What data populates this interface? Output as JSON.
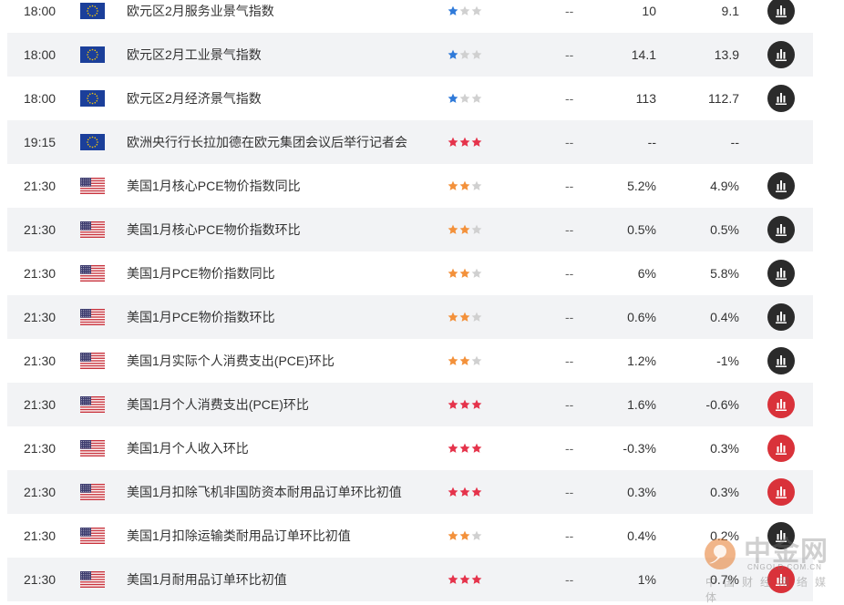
{
  "icons": {
    "eu_flag": "eu-flag-icon",
    "us_flag": "us-flag-icon",
    "star": "star-icon",
    "chart": "bar-chart-icon"
  },
  "colors": {
    "row_alt_bg": "#f2f3f5",
    "star_empty": "#d0d0d0",
    "star_blue": "#2f7ad9",
    "star_orange": "#f3913b",
    "star_red": "#e5334b",
    "btn_dark": "#2b2b2b",
    "btn_red": "#d9323a"
  },
  "events": [
    {
      "time": "18:00",
      "country": "eu",
      "title": "欧元区2月服务业景气指数",
      "importance": 1,
      "star_color": "blue",
      "previous": "--",
      "actual": "10",
      "forecast": "9.1",
      "chart": "dark"
    },
    {
      "time": "18:00",
      "country": "eu",
      "title": "欧元区2月工业景气指数",
      "importance": 1,
      "star_color": "blue",
      "previous": "--",
      "actual": "14.1",
      "forecast": "13.9",
      "chart": "dark"
    },
    {
      "time": "18:00",
      "country": "eu",
      "title": "欧元区2月经济景气指数",
      "importance": 1,
      "star_color": "blue",
      "previous": "--",
      "actual": "113",
      "forecast": "112.7",
      "chart": "dark"
    },
    {
      "time": "19:15",
      "country": "eu",
      "title": "欧洲央行行长拉加德在欧元集团会议后举行记者会",
      "importance": 3,
      "star_color": "red",
      "previous": "--",
      "actual": "--",
      "forecast": "--",
      "chart": "none"
    },
    {
      "time": "21:30",
      "country": "us",
      "title": "美国1月核心PCE物价指数同比",
      "importance": 2,
      "star_color": "orange",
      "previous": "--",
      "actual": "5.2%",
      "forecast": "4.9%",
      "chart": "dark"
    },
    {
      "time": "21:30",
      "country": "us",
      "title": "美国1月核心PCE物价指数环比",
      "importance": 2,
      "star_color": "orange",
      "previous": "--",
      "actual": "0.5%",
      "forecast": "0.5%",
      "chart": "dark"
    },
    {
      "time": "21:30",
      "country": "us",
      "title": "美国1月PCE物价指数同比",
      "importance": 2,
      "star_color": "orange",
      "previous": "--",
      "actual": "6%",
      "forecast": "5.8%",
      "chart": "dark"
    },
    {
      "time": "21:30",
      "country": "us",
      "title": "美国1月PCE物价指数环比",
      "importance": 2,
      "star_color": "orange",
      "previous": "--",
      "actual": "0.6%",
      "forecast": "0.4%",
      "chart": "dark"
    },
    {
      "time": "21:30",
      "country": "us",
      "title": "美国1月实际个人消费支出(PCE)环比",
      "importance": 2,
      "star_color": "orange",
      "previous": "--",
      "actual": "1.2%",
      "forecast": "-1%",
      "chart": "dark"
    },
    {
      "time": "21:30",
      "country": "us",
      "title": "美国1月个人消费支出(PCE)环比",
      "importance": 3,
      "star_color": "red",
      "previous": "--",
      "actual": "1.6%",
      "forecast": "-0.6%",
      "chart": "red"
    },
    {
      "time": "21:30",
      "country": "us",
      "title": "美国1月个人收入环比",
      "importance": 3,
      "star_color": "red",
      "previous": "--",
      "actual": "-0.3%",
      "forecast": "0.3%",
      "chart": "red"
    },
    {
      "time": "21:30",
      "country": "us",
      "title": "美国1月扣除飞机非国防资本耐用品订单环比初值",
      "importance": 3,
      "star_color": "red",
      "previous": "--",
      "actual": "0.3%",
      "forecast": "0.3%",
      "chart": "red"
    },
    {
      "time": "21:30",
      "country": "us",
      "title": "美国1月扣除运输类耐用品订单环比初值",
      "importance": 2,
      "star_color": "orange",
      "previous": "--",
      "actual": "0.4%",
      "forecast": "0.2%",
      "chart": "dark"
    },
    {
      "time": "21:30",
      "country": "us",
      "title": "美国1月耐用品订单环比初值",
      "importance": 3,
      "star_color": "red",
      "previous": "--",
      "actual": "1%",
      "forecast": "0.7%",
      "chart": "red"
    }
  ],
  "watermark": {
    "name": "中金网",
    "domain": "CNGOLD.COM.CN",
    "tagline": "中国财经网络媒体"
  }
}
